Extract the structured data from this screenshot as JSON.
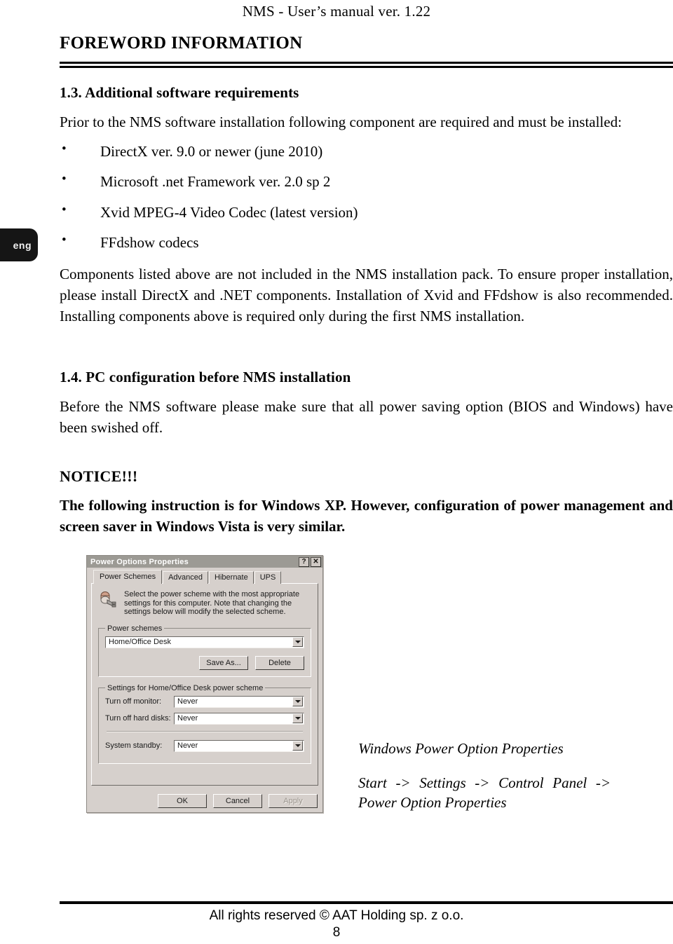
{
  "header": {
    "running_head": "NMS - User’s manual ver. 1.22",
    "chapter_title": "FOREWORD INFORMATION"
  },
  "language_tab": {
    "label": "eng"
  },
  "sections": {
    "s13": {
      "heading": "1.3. Additional software requirements",
      "intro": "Prior to the NMS software installation following component are required and must be installed:",
      "requirements": [
        "DirectX ver. 9.0 or newer (june 2010)",
        "Microsoft .net Framework ver. 2.0 sp 2",
        "Xvid MPEG-4 Video Codec (latest version)",
        "FFdshow codecs"
      ],
      "note": "Components listed above are not included in the NMS installation pack. To ensure proper installation, please install DirectX and .NET components. Installation of Xvid and FFdshow is also recommended. Installing components above is required only during the first NMS installation."
    },
    "s14": {
      "heading": "1.4. PC configuration before NMS installation",
      "body": "Before the NMS software please make sure that all power saving option (BIOS and Windows) have been swished off."
    },
    "notice": {
      "title": "NOTICE!!!",
      "body": "The following instruction is for Windows XP. However, configuration of power management and screen saver in Windows Vista is very similar."
    }
  },
  "figure": {
    "caption_title": "Windows Power Option Properties",
    "caption_path": "Start -> Settings -> Control Panel -> Power Option Properties",
    "dialog": {
      "title": "Power Options Properties",
      "titlebar_buttons": [
        {
          "icon": "help-icon",
          "glyph": "?"
        },
        {
          "icon": "close-icon",
          "glyph": "✕"
        }
      ],
      "tabs": [
        {
          "label": "Power Schemes",
          "active": true
        },
        {
          "label": "Advanced",
          "active": false
        },
        {
          "label": "Hibernate",
          "active": false
        },
        {
          "label": "UPS",
          "active": false
        }
      ],
      "intro_text": "Select the power scheme with the most appropriate settings for this computer. Note that changing the settings below will modify the selected scheme.",
      "power_schemes_group": {
        "legend": "Power schemes",
        "selected_scheme": "Home/Office Desk",
        "buttons": [
          {
            "label": "Save As...",
            "disabled": false
          },
          {
            "label": "Delete",
            "disabled": false
          }
        ]
      },
      "settings_group": {
        "legend": "Settings for Home/Office Desk power scheme",
        "rows": [
          {
            "label": "Turn off monitor:",
            "value": "Never"
          },
          {
            "label": "Turn off hard disks:",
            "value": "Never"
          },
          {
            "label": "System standby:",
            "value": "Never"
          }
        ]
      },
      "footer_buttons": [
        {
          "label": "OK",
          "disabled": false
        },
        {
          "label": "Cancel",
          "disabled": false
        },
        {
          "label": "Apply",
          "disabled": true
        }
      ]
    }
  },
  "footer": {
    "copyright": "All rights reserved © AAT Holding sp. z o.o.",
    "page_number": "8"
  }
}
